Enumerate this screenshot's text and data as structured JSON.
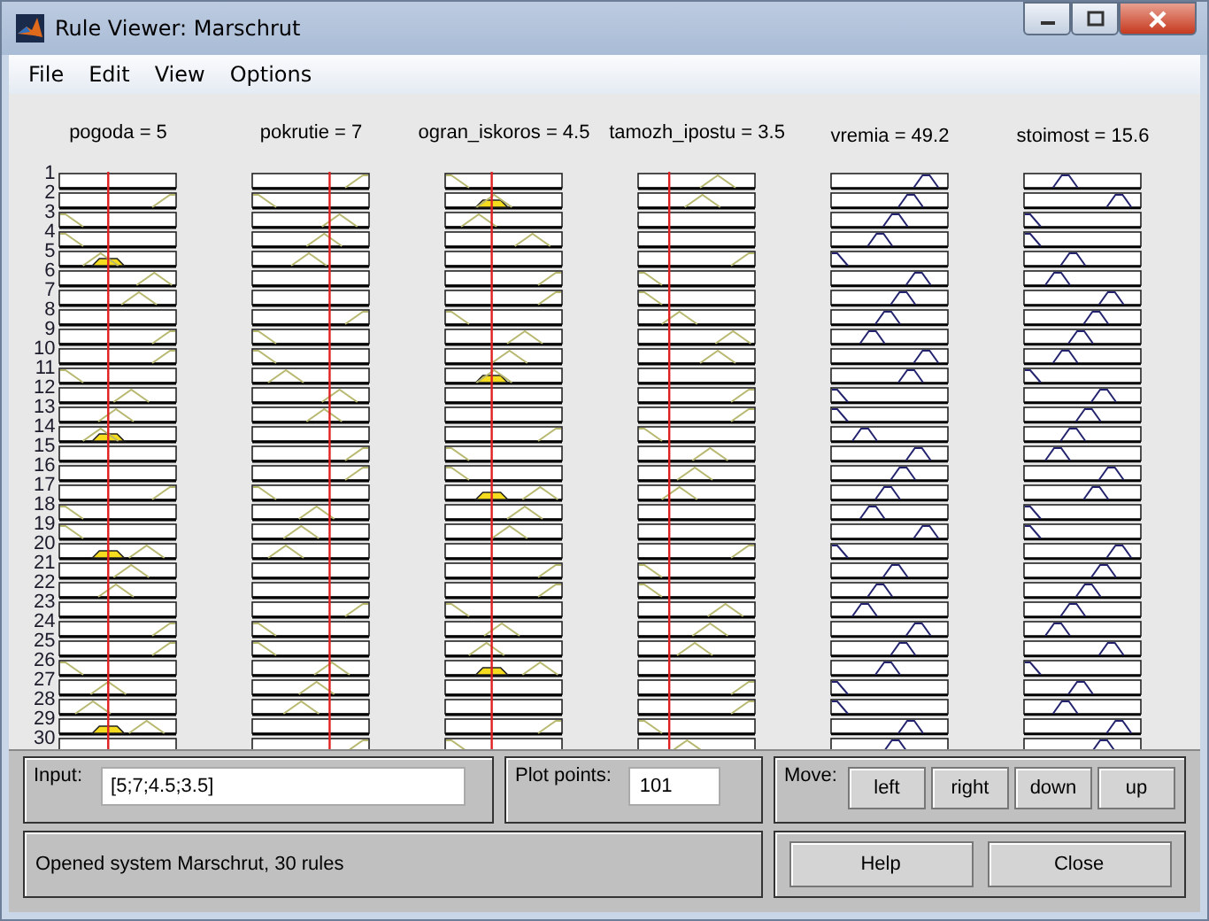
{
  "window": {
    "title": "Rule Viewer: Marschrut"
  },
  "menu": [
    {
      "label": "File"
    },
    {
      "label": "Edit"
    },
    {
      "label": "View"
    },
    {
      "label": "Options"
    }
  ],
  "variables": [
    {
      "label": "pogoda = 5",
      "kind": "input"
    },
    {
      "label": "pokrutie = 7",
      "kind": "input"
    },
    {
      "label": "ogran_iskoros = 4.5",
      "kind": "input"
    },
    {
      "label": "tamozh_ipostu = 3.5",
      "kind": "input"
    },
    {
      "label": "vremia = 49.2",
      "kind": "output"
    },
    {
      "label": "stoimost = 15.6",
      "kind": "output"
    }
  ],
  "rules": [
    "1",
    "2",
    "3",
    "4",
    "5",
    "6",
    "7",
    "8",
    "9",
    "10",
    "11",
    "12",
    "13",
    "14",
    "15",
    "16",
    "17",
    "18",
    "19",
    "20",
    "21",
    "22",
    "23",
    "24",
    "25",
    "26",
    "27",
    "28",
    "29",
    "30"
  ],
  "input": {
    "label": "Input:",
    "value": "[5;7;4.5;3.5]"
  },
  "plot_points": {
    "label": "Plot points:",
    "value": "101"
  },
  "move": {
    "label": "Move:",
    "buttons": [
      "left",
      "right",
      "down",
      "up"
    ]
  },
  "status": "Opened system Marschrut, 30 rules",
  "buttons": [
    "Help",
    "Close"
  ]
}
